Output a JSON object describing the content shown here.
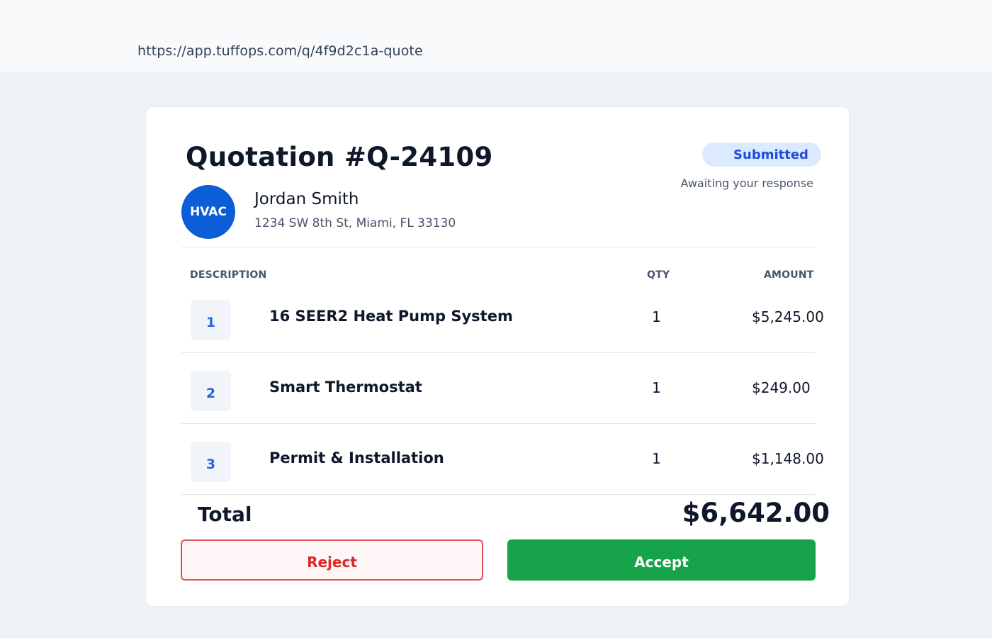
{
  "browser": {
    "url": "https://app.tuffops.com/q/4f9d2c1a-quote"
  },
  "quote": {
    "title": "Quotation #Q-24109",
    "status": "Submitted",
    "status_subtext": "Awaiting your response",
    "avatar_text": "HVAC",
    "customer_name": "Jordan Smith",
    "customer_address": "1234 SW 8th St, Miami, FL 33130"
  },
  "table": {
    "headers": {
      "description": "DESCRIPTION",
      "qty": "QTY",
      "amount": "AMOUNT"
    },
    "rows": [
      {
        "num": "1",
        "description": "16 SEER2 Heat Pump System",
        "qty": "1",
        "amount": "$5,245.00"
      },
      {
        "num": "2",
        "description": "Smart Thermostat",
        "qty": "1",
        "amount": "$249.00"
      },
      {
        "num": "3",
        "description": "Permit & Installation",
        "qty": "1",
        "amount": "$1,148.00"
      }
    ]
  },
  "totals": {
    "label": "Total",
    "value": "$6,642.00"
  },
  "actions": {
    "reject_label": "Reject",
    "accept_label": "Accept"
  },
  "colors": {
    "brand_blue": "#0b5ed7",
    "status_badge_bg": "#dbeafe",
    "status_badge_text": "#1d4ed8",
    "accept_green": "#16a34a",
    "reject_red": "#dc2626"
  }
}
